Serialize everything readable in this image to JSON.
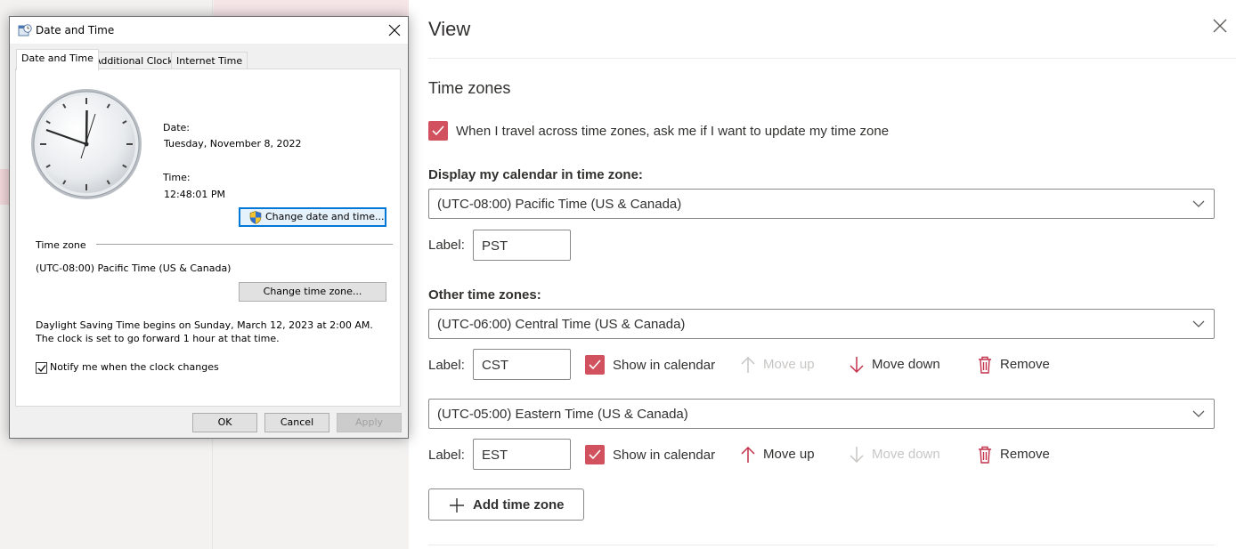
{
  "dialog": {
    "title": "Date and Time",
    "tabs": [
      "Date and Time",
      "Additional Clocks",
      "Internet Time"
    ],
    "date_label": "Date:",
    "date_value": "Tuesday, November 8, 2022",
    "time_label": "Time:",
    "time_value": "12:48:01 PM",
    "change_datetime_button": "Change date and time...",
    "timezone_heading": "Time zone",
    "timezone_value": "(UTC-08:00) Pacific Time (US & Canada)",
    "change_timezone_button": "Change time zone...",
    "dst_text": "Daylight Saving Time begins on Sunday, March 12, 2023 at 2:00 AM. The clock is set to go forward 1 hour at that time.",
    "notify_label": "Notify me when the clock changes",
    "notify_checked": true,
    "ok_button": "OK",
    "cancel_button": "Cancel",
    "apply_button": "Apply"
  },
  "panel": {
    "title": "View",
    "section_title": "Time zones",
    "travel_prompt": "When I travel across time zones, ask me if I want to update my time zone",
    "travel_prompt_checked": true,
    "display_heading": "Display my calendar in time zone:",
    "display_zone": "(UTC-08:00) Pacific Time (US & Canada)",
    "label_caption": "Label:",
    "display_label_value": "PST",
    "other_heading": "Other time zones:",
    "other_zones": [
      {
        "zone": "(UTC-06:00) Central Time (US & Canada)",
        "label": "CST",
        "show_in_calendar": "Show in calendar",
        "move_up": "Move up",
        "move_up_enabled": false,
        "move_down": "Move down",
        "move_down_enabled": true,
        "remove": "Remove"
      },
      {
        "zone": "(UTC-05:00) Eastern Time (US & Canada)",
        "label": "EST",
        "show_in_calendar": "Show in calendar",
        "move_up": "Move up",
        "move_up_enabled": true,
        "move_down": "Move down",
        "move_down_enabled": false,
        "remove": "Remove"
      }
    ],
    "add_button": "Add time zone"
  },
  "colors": {
    "accent": "#d1525e",
    "icon_red": "#c4314b",
    "disabled": "#c8c6c4",
    "focus_blue": "#0078d7"
  },
  "icons": {
    "close": "close-icon",
    "chevron": "chevron-down-icon",
    "move_up": "arrow-up-icon",
    "move_down": "arrow-down-icon",
    "remove": "trash-icon",
    "add": "plus-icon",
    "shield": "uac-shield-icon",
    "clock": "analog-clock-icon"
  }
}
